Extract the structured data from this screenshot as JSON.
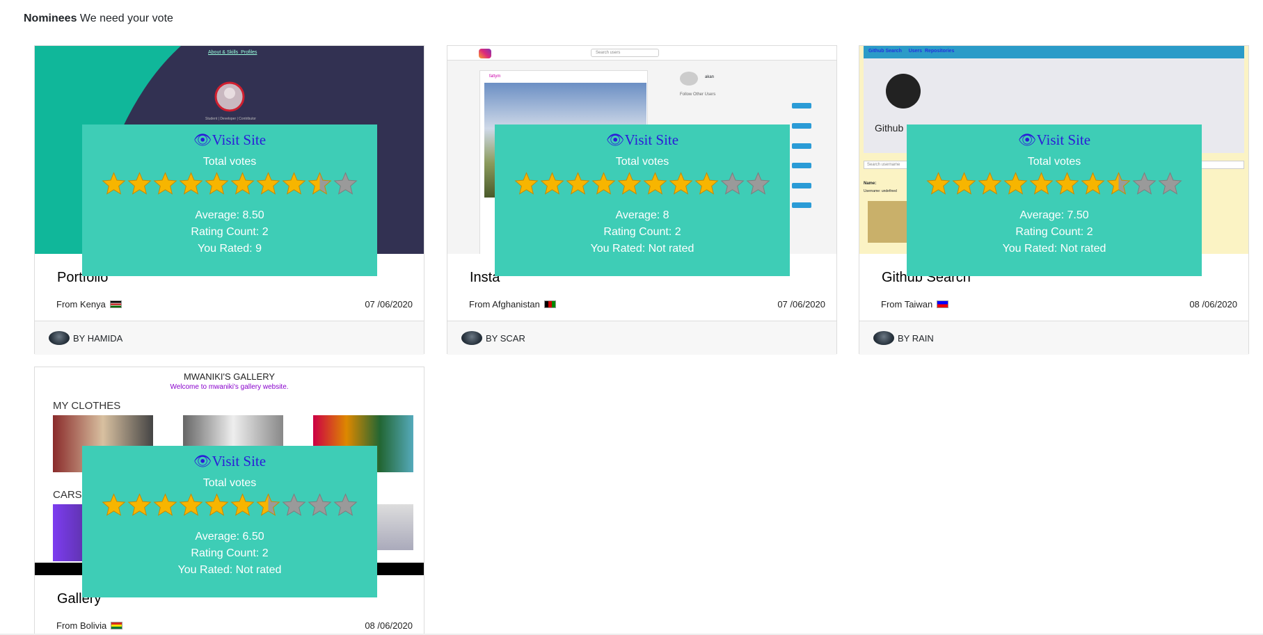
{
  "heading": {
    "bold": "Nominees",
    "rest": " We need your vote"
  },
  "colors": {
    "overlay": "#3ecdb6",
    "visit_link": "#2b1bd8",
    "star_gold": "#f7b500",
    "star_gray": "#9a9a9a"
  },
  "cards": [
    {
      "title": "Portfolio",
      "from": "From Kenya",
      "date": "07 /06/2020",
      "author": "BY HAMIDA",
      "visit": "Visit Site",
      "total_votes": "Total votes",
      "average": "Average: 8.50",
      "rating_count": "Rating Count: 2",
      "you_rated": "You Rated: 9",
      "rating": 8.5,
      "flag": "kenya",
      "shot": {
        "nav1": "About & Skills",
        "nav2": "Profiles",
        "caption": "Student | Developer | Contributor"
      }
    },
    {
      "title": "Insta",
      "from": "From Afghanistan",
      "date": "07 /06/2020",
      "author": "BY SCAR",
      "visit": "Visit Site",
      "total_votes": "Total votes",
      "average": "Average: 8",
      "rating_count": "Rating Count: 2",
      "you_rated": "You Rated: Not rated",
      "rating": 8,
      "flag": "afghanistan",
      "shot": {
        "search": "Search users",
        "user": "fattym",
        "me": "akan",
        "follow_heading": "Follow Other Users",
        "follow": "Follow"
      }
    },
    {
      "title": "Github Search",
      "from": "From Taiwan",
      "date": "08 /06/2020",
      "author": "BY RAIN",
      "visit": "Visit Site",
      "total_votes": "Total votes",
      "average": "Average: 7.50",
      "rating_count": "Rating Count: 2",
      "you_rated": "You Rated: Not rated",
      "rating": 7.5,
      "flag": "taiwan",
      "shot": {
        "brand": "Github Search",
        "users": "Users",
        "repos": "Repositories",
        "logo_text": "Github",
        "search": "Search username",
        "name": "Name:",
        "username": "Username: undefined"
      }
    },
    {
      "title": "Gallery",
      "from": "From Bolivia",
      "date": "08 /06/2020",
      "author": "",
      "visit": "Visit Site",
      "total_votes": "Total votes",
      "average": "Average: 6.50",
      "rating_count": "Rating Count: 2",
      "you_rated": "You Rated: Not rated",
      "rating": 6.5,
      "flag": "bolivia",
      "shot": {
        "heading": "MWANIKI'S GALLERY",
        "welcome": "Welcome to mwaniki's gallery website.",
        "section1": "MY CLOTHES",
        "section2": "CARS"
      }
    }
  ]
}
